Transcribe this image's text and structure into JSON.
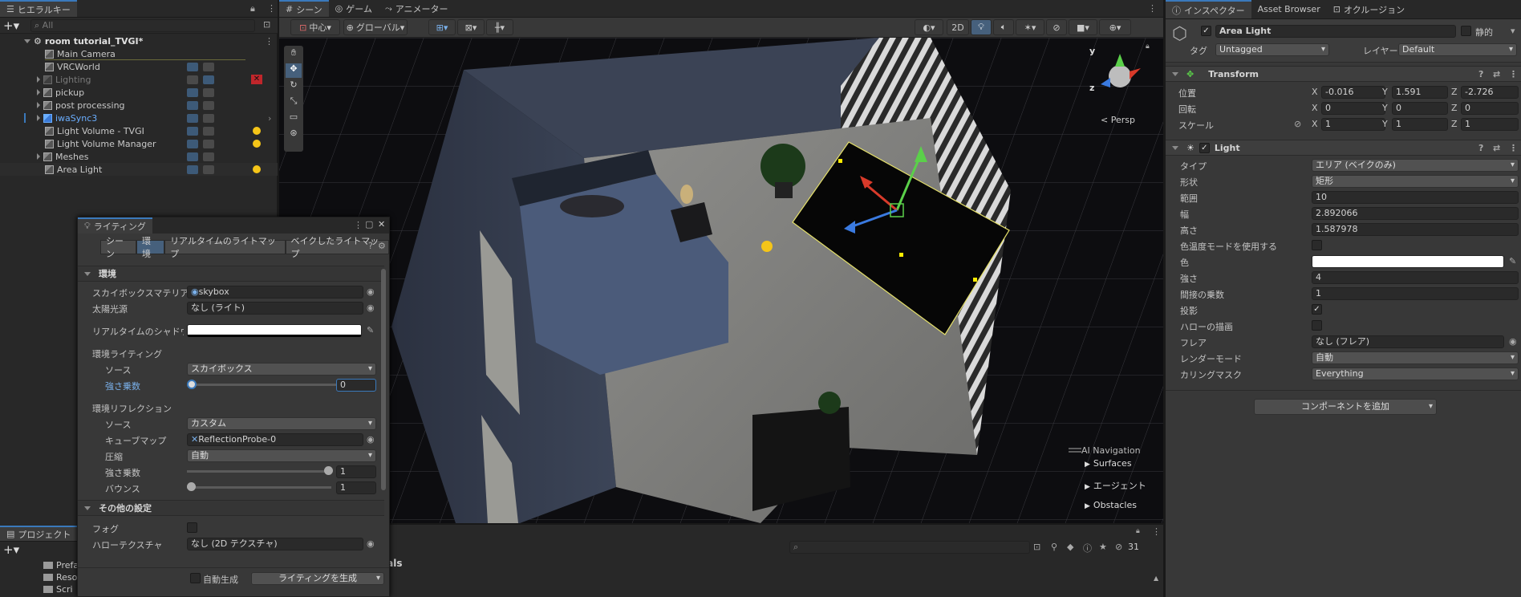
{
  "hierarchy": {
    "tab_label": "ヒエラルキー",
    "search_placeholder": "All",
    "scene_name": "room tutorial_TVGI*",
    "items": [
      {
        "label": "Main Camera"
      },
      {
        "label": "VRCWorld"
      },
      {
        "label": "Lighting"
      },
      {
        "label": "pickup"
      },
      {
        "label": "post processing"
      },
      {
        "label": "iwaSync3"
      },
      {
        "label": "Light Volume - TVGI"
      },
      {
        "label": "Light Volume Manager"
      },
      {
        "label": "Meshes"
      },
      {
        "label": "Area Light"
      }
    ]
  },
  "project": {
    "tab_label": "プロジェクト",
    "folders": [
      "Prefa",
      "Reso",
      "Scri"
    ]
  },
  "lighting": {
    "title": "ライティング",
    "tabs": [
      "シーン",
      "環境",
      "リアルタイムのライトマップ",
      "ベイクしたライトマップ"
    ],
    "environment_section": "環境",
    "skybox_label": "スカイボックスマテリアル",
    "skybox_value": "skybox",
    "sun_label": "太陽光源",
    "sun_value": "なし (ライト)",
    "shadow_label": "リアルタイムのシャドウカラー",
    "env_lighting_label": "環境ライティング",
    "source_label": "ソース",
    "source_value": "スカイボックス",
    "intensity_label": "強さ乗数",
    "intensity_value": "0",
    "env_reflection_label": "環境リフレクション",
    "refl_source_label": "ソース",
    "refl_source_value": "カスタム",
    "cubemap_label": "キューブマップ",
    "cubemap_value": "ReflectionProbe-0",
    "compression_label": "圧縮",
    "compression_value": "自動",
    "refl_intensity_label": "強さ乗数",
    "refl_intensity_value": "1",
    "bounce_label": "バウンス",
    "bounce_value": "1",
    "other_section": "その他の設定",
    "fog_label": "フォグ",
    "halo_label": "ハローテクスチャ",
    "halo_value": "なし (2D テクスチャ)",
    "auto_gen_label": "自動生成",
    "generate_label": "ライティングを生成"
  },
  "scene": {
    "tabs": [
      "シーン",
      "ゲーム",
      "アニメーター"
    ],
    "pivot_label": "中心",
    "global_label": "グローバル",
    "mode_2d": "2D",
    "persp_label": "< Persp",
    "gizmo_y": "y",
    "gizmo_z": "z",
    "ai_nav_title": "AI Navigation",
    "ai_nav_items": [
      "Surfaces",
      "エージェント",
      "Obstacles"
    ],
    "console_count": "31",
    "partial_text": "ials"
  },
  "inspector": {
    "tabs": [
      "インスペクター",
      "Asset Browser",
      "オクルージョン"
    ],
    "object_name": "Area Light",
    "static_label": "静的",
    "tag_label": "タグ",
    "tag_value": "Untagged",
    "layer_label": "レイヤー",
    "layer_value": "Default",
    "transform": {
      "title": "Transform",
      "position_label": "位置",
      "rotation_label": "回転",
      "scale_label": "スケール",
      "position": {
        "x": "-0.016",
        "y": "1.591",
        "z": "-2.726"
      },
      "rotation": {
        "x": "0",
        "y": "0",
        "z": "0"
      },
      "scale": {
        "x": "1",
        "y": "1",
        "z": "1"
      }
    },
    "light": {
      "title": "Light",
      "rows": [
        {
          "label": "タイプ",
          "value": "エリア (ベイクのみ)"
        },
        {
          "label": "形状",
          "value": "矩形"
        },
        {
          "label": "範囲",
          "value": "10"
        },
        {
          "label": "幅",
          "value": "2.892066"
        },
        {
          "label": "高さ",
          "value": "1.587978"
        },
        {
          "label": "色温度モードを使用する",
          "value": ""
        },
        {
          "label": "色",
          "value": ""
        },
        {
          "label": "強さ",
          "value": "4"
        },
        {
          "label": "間接の乗数",
          "value": "1"
        },
        {
          "label": "投影",
          "value": ""
        },
        {
          "label": "ハローの描画",
          "value": ""
        },
        {
          "label": "フレア",
          "value": "なし (フレア)"
        },
        {
          "label": "レンダーモード",
          "value": "自動"
        },
        {
          "label": "カリングマスク",
          "value": "Everything"
        }
      ]
    },
    "add_component": "コンポーネントを追加"
  },
  "colors": {
    "accent": "#3a79bb",
    "bulb": "#f5c518",
    "selected_row": "#2c2c2c"
  }
}
